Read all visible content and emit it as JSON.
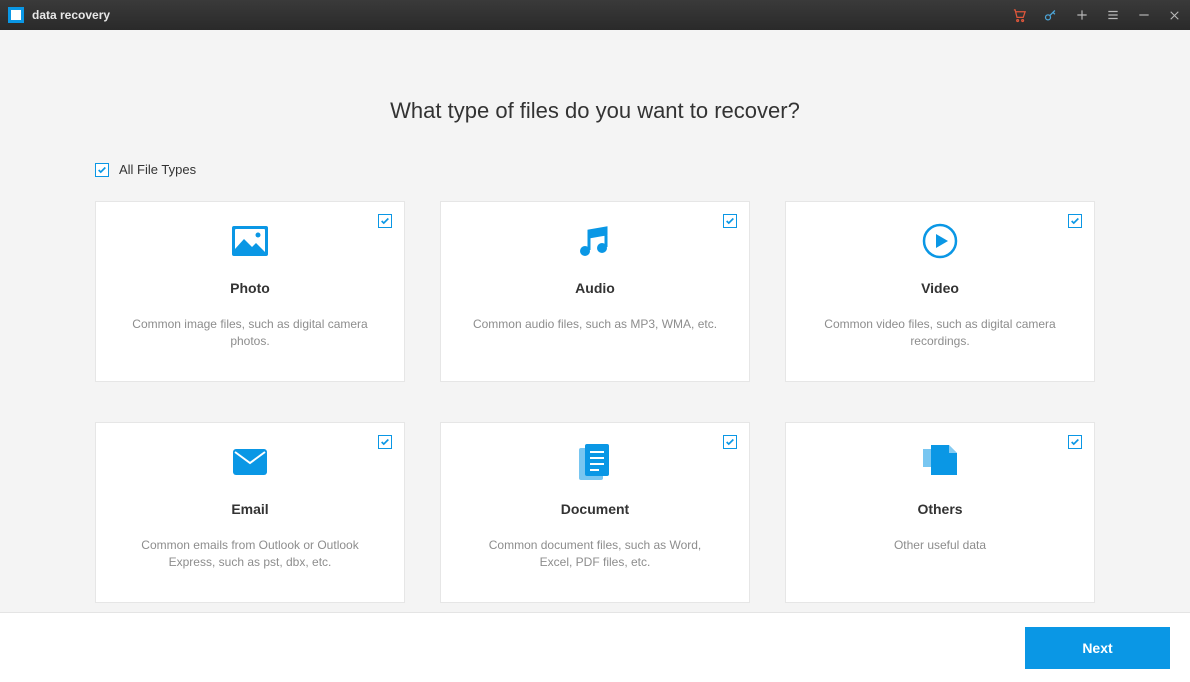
{
  "app": {
    "title": "data recovery"
  },
  "heading": "What type of files do you want to recover?",
  "allTypes": {
    "label": "All File Types",
    "checked": true
  },
  "cards": [
    {
      "title": "Photo",
      "desc": "Common image files, such as digital camera photos.",
      "checked": true
    },
    {
      "title": "Audio",
      "desc": "Common audio files, such as MP3, WMA, etc.",
      "checked": true
    },
    {
      "title": "Video",
      "desc": "Common video files, such as digital camera recordings.",
      "checked": true
    },
    {
      "title": "Email",
      "desc": "Common emails from Outlook or Outlook Express, such as pst, dbx, etc.",
      "checked": true
    },
    {
      "title": "Document",
      "desc": "Common document files, such as Word, Excel, PDF files, etc.",
      "checked": true
    },
    {
      "title": "Others",
      "desc": "Other useful data",
      "checked": true
    }
  ],
  "footer": {
    "next": "Next"
  },
  "colors": {
    "accent": "#0a97e5",
    "cart": "#e0573b",
    "titlebarIcon": "#9a9a9a"
  }
}
